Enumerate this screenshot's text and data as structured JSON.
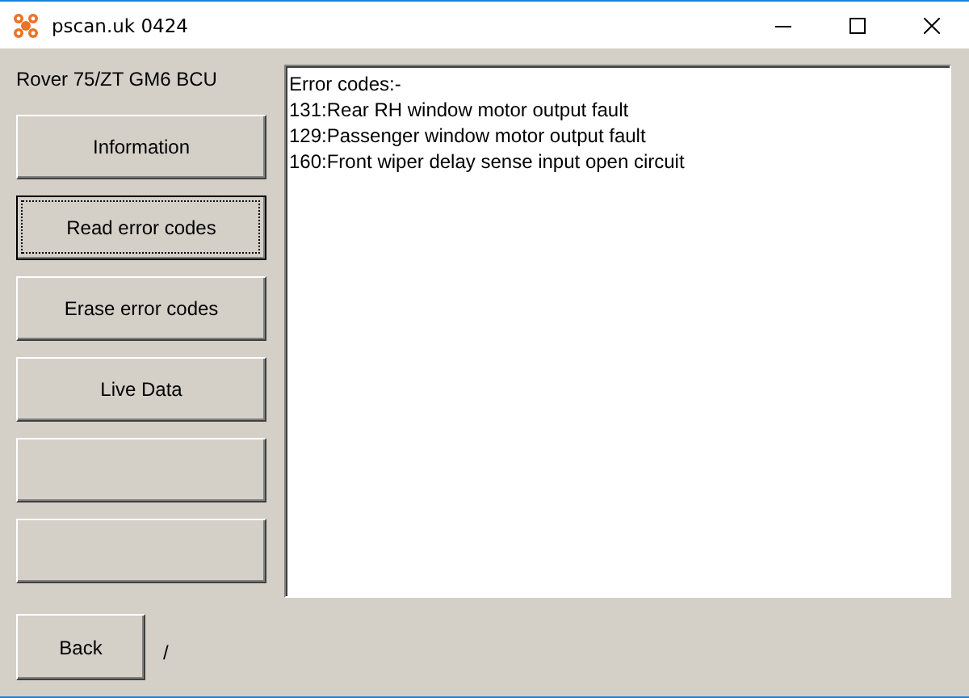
{
  "window": {
    "title": "pscan.uk 0424"
  },
  "module_label": "Rover 75/ZT GM6 BCU",
  "buttons": [
    {
      "label": "Information",
      "focused": false
    },
    {
      "label": "Read error codes",
      "focused": true
    },
    {
      "label": "Erase error codes",
      "focused": false
    },
    {
      "label": "Live Data",
      "focused": false
    },
    {
      "focused": false
    },
    {
      "focused": false
    }
  ],
  "output_lines": [
    "Error codes:-",
    "131:Rear RH window motor output fault",
    "129:Passenger window motor output fault",
    "160:Front wiper delay sense input open circuit"
  ],
  "back_button": {
    "label": "Back",
    "focused": false
  },
  "status_text": "/"
}
